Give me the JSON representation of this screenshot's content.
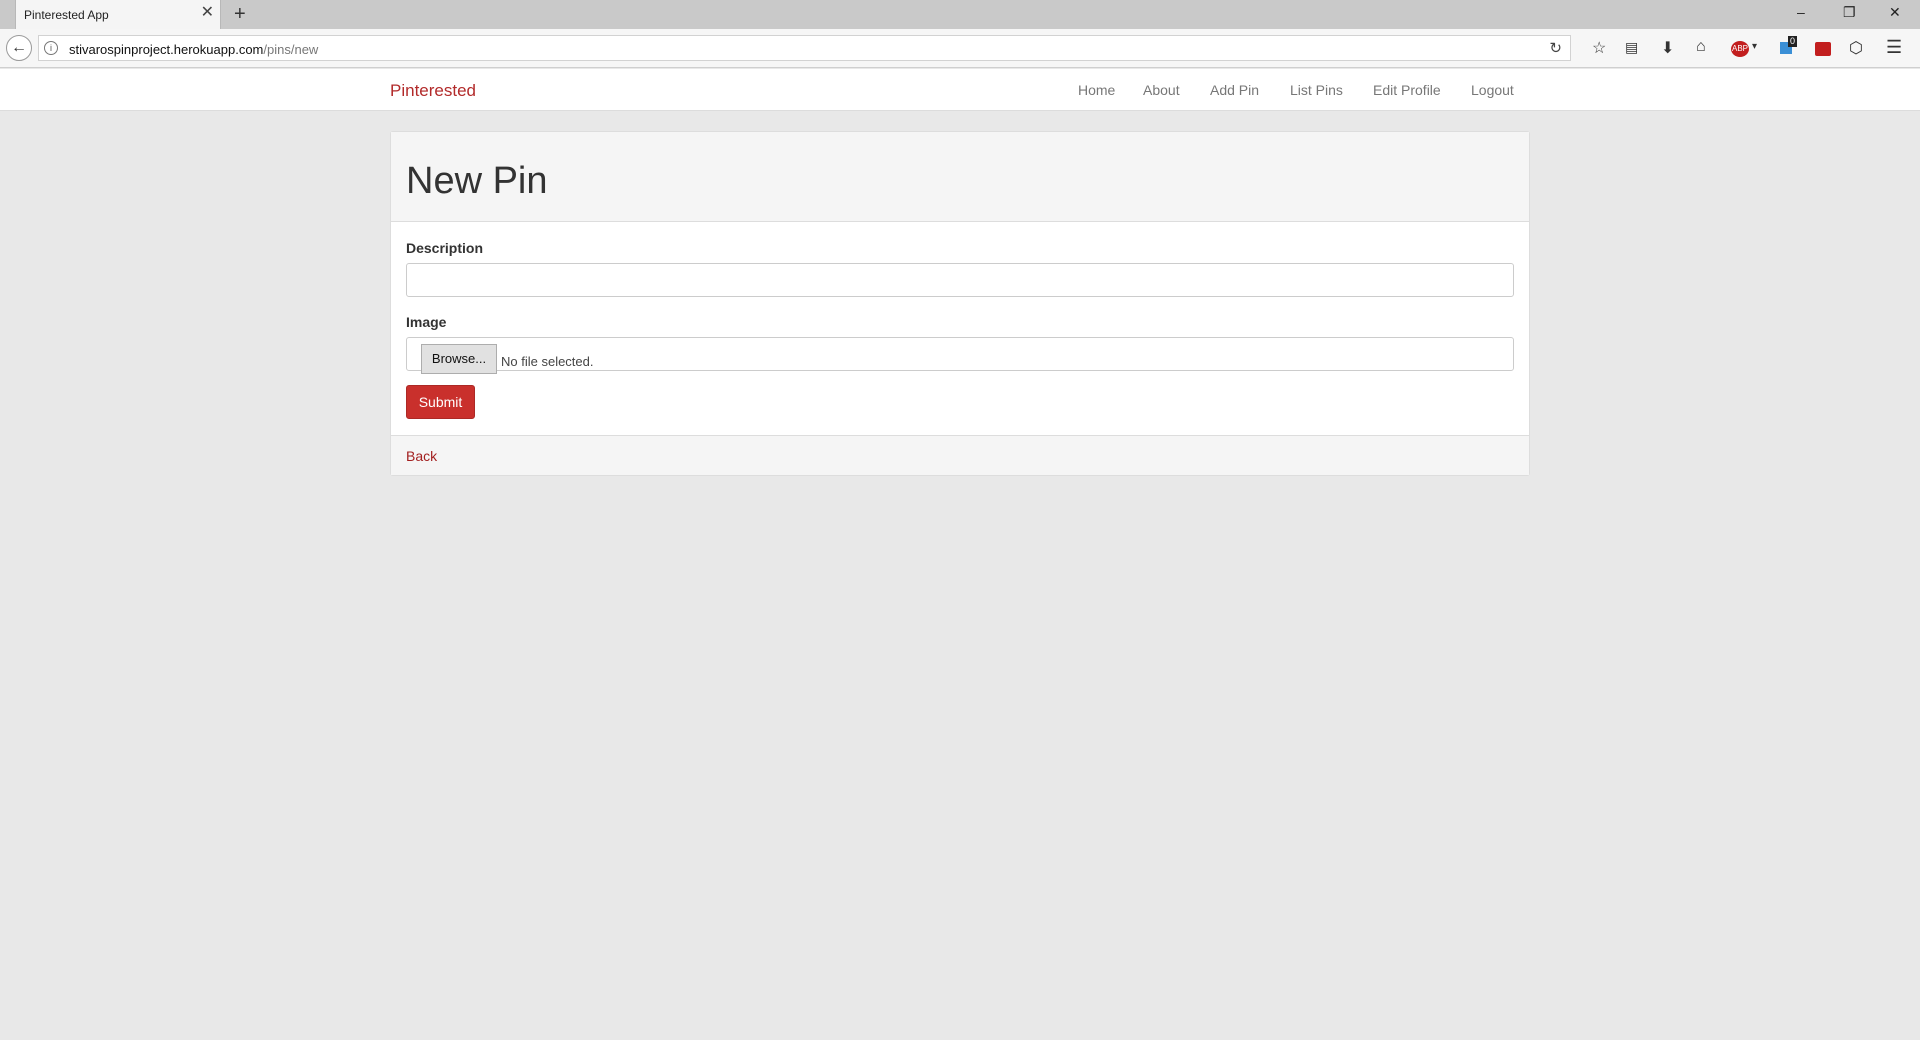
{
  "browser": {
    "tab_title": "Pinterested App",
    "tab_close": "✕",
    "new_tab": "+",
    "url_host": "stivarospinproject.herokuapp.com",
    "url_path": "/pins/new",
    "window_controls": {
      "minimize": "–",
      "restore": "❐",
      "close": "✕"
    },
    "toolbar_icons": [
      "star-icon",
      "reading-list-icon",
      "download-icon",
      "home-icon",
      "adblock-icon",
      "extension-badge-icon",
      "lastpass-icon",
      "shield-icon",
      "menu-icon"
    ],
    "extension_badge_count": "0",
    "adblock_label": "ABP"
  },
  "app_nav": {
    "brand": "Pinterested",
    "links": [
      "Home",
      "About",
      "Add Pin",
      "List Pins",
      "Edit Profile",
      "Logout"
    ]
  },
  "form": {
    "title": "New Pin",
    "description_label": "Description",
    "description_value": "",
    "image_label": "Image",
    "browse_label": "Browse...",
    "no_file_text": "No file selected.",
    "submit_label": "Submit",
    "back_label": "Back"
  },
  "colors": {
    "brand": "#b22a2a",
    "submit": "#c9302c",
    "background": "#e8e8e8"
  }
}
